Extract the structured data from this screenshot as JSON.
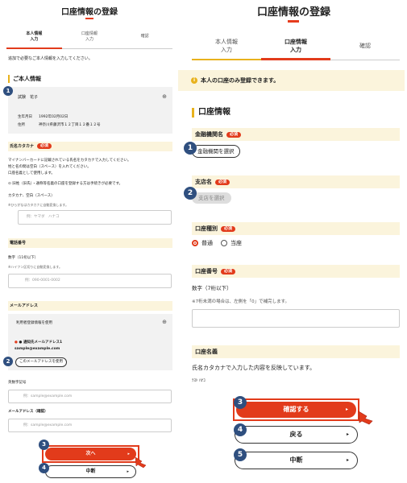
{
  "left": {
    "title": "口座情報の登録",
    "tabs": [
      {
        "label1": "本人情報",
        "label2": "入力"
      },
      {
        "label1": "口座情報",
        "label2": "入力"
      },
      {
        "label1": "確認",
        "label2": ""
      }
    ],
    "intro": "追加で必要なご本人情報を入力してください。",
    "section_title": "ご本人情報",
    "person": {
      "name": "試験　花子",
      "dob_label": "生年月日",
      "dob": "1992年02月02日",
      "addr_label": "住所",
      "addr": "神奈川県藤沢市１２丁目１２番１２号"
    },
    "kana": {
      "label": "氏名カタカナ",
      "badge": "必須",
      "desc1": "マイナンバーカードに記載されている氏名をカタカナで入力してください。",
      "desc2": "姓と名の間は空白（スペース）を入れてください。",
      "desc3": "口座名義として使用します。",
      "note": "⊙ 旧姓（旧氏）・通称等名義の口座を登録する方は手続きが必要です。",
      "sublabel": "カタカナ、空白（スペース）",
      "subnote": "※ひらがなはカタカナに自動変換します。",
      "placeholder": "例：ヤマダ　ハナコ"
    },
    "phone": {
      "label": "電話番号",
      "sublabel": "数字（11桁以下）",
      "subnote": "※ハイフン区切りに自動変換します。",
      "placeholder": "例：090-0001-0002"
    },
    "mail": {
      "label": "メールアドレス",
      "use_reg": "利用者登録情報を使用",
      "notify_label": "● 通知先メールアドレス1",
      "notify_value": "sample@example.com",
      "use_btn": "このメールアドレスを使用",
      "alt_label": "英数字記号",
      "alt_placeholder": "例：sample@example.com",
      "confirm_label": "メールアドレス（確認）",
      "confirm_placeholder": "例：sample@example.com"
    },
    "next_btn": "次へ",
    "cancel_btn": "中断",
    "markers": [
      "1",
      "2",
      "3",
      "4"
    ]
  },
  "right": {
    "title": "口座情報の登録",
    "tabs": [
      {
        "label1": "本人情報",
        "label2": "入力"
      },
      {
        "label1": "口座情報",
        "label2": "入力"
      },
      {
        "label1": "確認",
        "label2": ""
      }
    ],
    "notice": "本人の口座のみ登録できます。",
    "section_title": "口座情報",
    "bank": {
      "label": "金融機関名",
      "badge": "必須",
      "btn": "金融機関を選択"
    },
    "branch": {
      "label": "支店名",
      "badge": "必須",
      "btn": "支店を選択"
    },
    "type": {
      "label": "口座種別",
      "badge": "必須",
      "opt1": "普通",
      "opt2": "当座"
    },
    "number": {
      "label": "口座番号",
      "badge": "必須",
      "sublabel": "数字（7桁以下）",
      "subnote": "※7桁未満の場合は、左側を「0」で補完します。"
    },
    "holder": {
      "label": "口座名義",
      "desc": "氏名カタカナで入力した内容を反映しています。",
      "value": "ﾃｽﾄ ﾊﾅｺ"
    },
    "confirm_btn": "確認する",
    "back_btn": "戻る",
    "cancel_btn": "中断",
    "markers": [
      "1",
      "2",
      "3",
      "4",
      "5"
    ]
  },
  "colors": {
    "accent": "#e23b1b",
    "marker": "#2f4f7f",
    "yellow": "#fbf4dc",
    "gold": "#e8b21d"
  }
}
